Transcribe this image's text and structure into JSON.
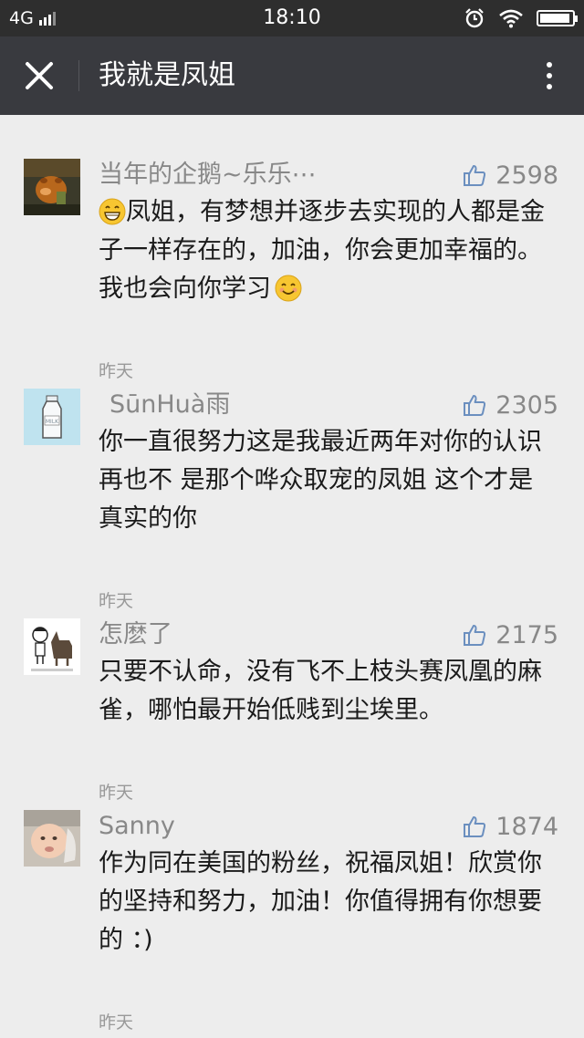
{
  "status_bar": {
    "network": "4G",
    "time": "18:10"
  },
  "header": {
    "title": "我就是凤姐"
  },
  "comments": [
    {
      "name": "当年的企鹅~乐乐⋯",
      "likes": "2598",
      "text_parts": [
        "凤姐，有梦想并逐步去实现的人都是金子一样存在的，加油，你会更加幸福的。我也会向你学习"
      ],
      "time": "昨天"
    },
    {
      "name": "SūnHuà雨",
      "likes": "2305",
      "text": "你一直很努力这是我最近两年对你的认识 再也不 是那个哗众取宠的凤姐 这个才是真实的你",
      "time": "昨天"
    },
    {
      "name": "怎麽了",
      "likes": "2175",
      "text": "只要不认命，没有飞不上枝头赛凤凰的麻雀，哪怕最开始低贱到尘埃里。",
      "time": "昨天"
    },
    {
      "name": "Sanny",
      "likes": "1874",
      "text": "作为同在美国的粉丝，祝福凤姐！欣赏你的坚持和努力，加油！你值得拥有你想要的 ：)",
      "time": "昨天"
    }
  ],
  "avatars": {
    "c1": "cartoon-pig-avatar",
    "c2": "milk-bottle-avatar",
    "c3": "boy-and-donkey-avatar",
    "c4": "baby-photo-avatar"
  },
  "milk_label": "MILK",
  "colors": {
    "status_bar": "#2e2e2e",
    "nav_bar": "#393a3f",
    "background": "#ededed",
    "name": "#888888",
    "text": "#1a1a1a"
  }
}
